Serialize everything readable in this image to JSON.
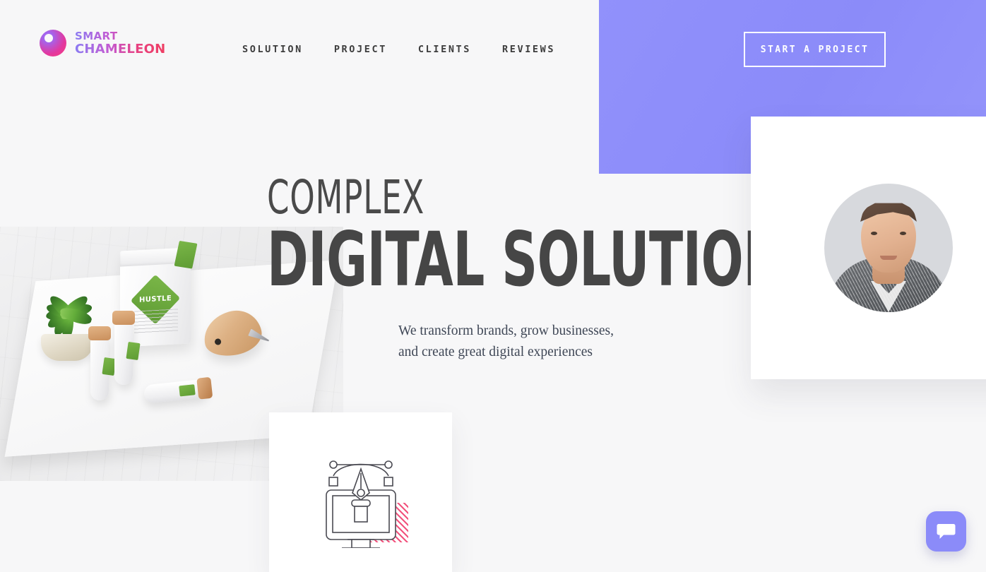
{
  "brand": {
    "name_line1": "SMART",
    "name_line2": "CHAMELEON",
    "mark_colors": {
      "start": "#a265ee",
      "end": "#f93b7c"
    },
    "word_gradient": {
      "start": "#8b7bf2",
      "end": "#ef3f63"
    }
  },
  "nav": {
    "items": [
      {
        "label": "SOLUTION"
      },
      {
        "label": "PROJECT"
      },
      {
        "label": "CLIENTS"
      },
      {
        "label": "REVIEWS"
      }
    ]
  },
  "header": {
    "cta_label": "START A PROJECT",
    "cta_block_color": "#8b8bf9",
    "cta_text_color": "#ffffff"
  },
  "hero": {
    "headline_light": "COMPLEX",
    "headline_bold": "DIGITAL SOLUTIONS",
    "headline_color": "#464646",
    "subtitle": "We transform brands, grow businesses,\nand create great digital experiences",
    "subtitle_color": "#3f4756"
  },
  "mockup": {
    "alt": "branding product mockup photo",
    "pouch_brand": "HUSTLE",
    "accent_color": "#7ab648"
  },
  "portrait_card": {
    "alt": "team member portrait photo",
    "background": "#ffffff"
  },
  "icon_card": {
    "icon_name": "pen-tool-monitor-icon",
    "hatch_color": "#f2537d",
    "background": "#ffffff"
  },
  "chat": {
    "icon_name": "chat-bubble-icon",
    "background": "#8b8bf9"
  },
  "page": {
    "background": "#f7f7f8"
  }
}
